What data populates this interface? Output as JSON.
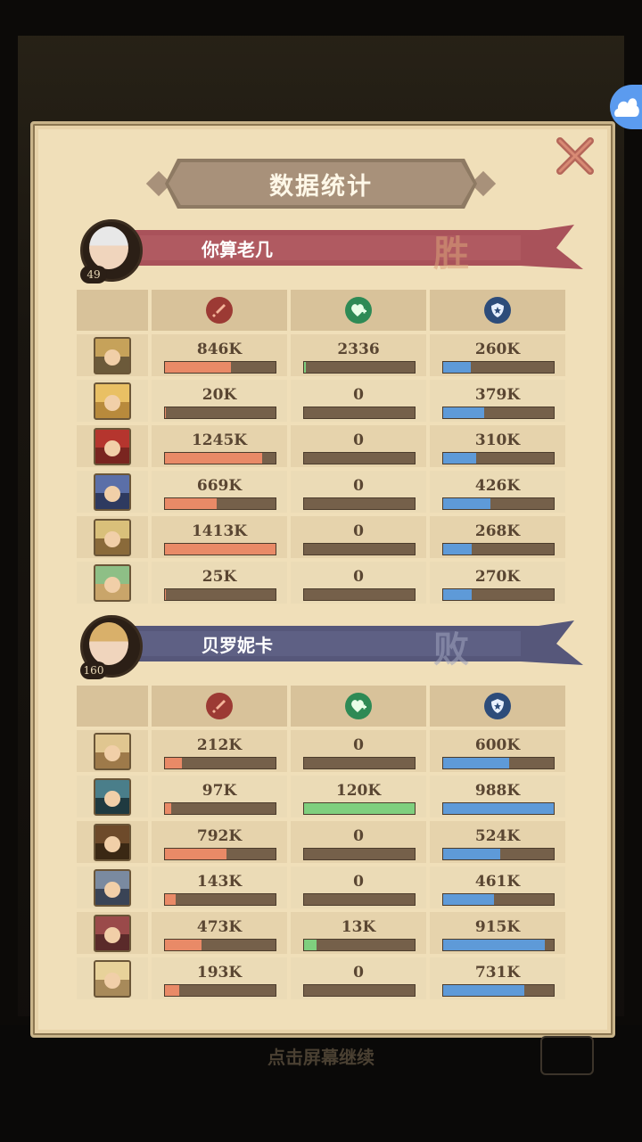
{
  "title": "数据统计",
  "continue_text": "点击屏幕继续",
  "colors": {
    "damage": "#e98a67",
    "healing": "#7fcf7e",
    "tank": "#5e9ad8",
    "win_banner": "#a9525a",
    "lose_banner": "#56577a"
  },
  "column_icons": [
    "sword-icon",
    "heart-plus-icon",
    "shield-icon"
  ],
  "teams": [
    {
      "name": "你算老几",
      "level": "49",
      "result": "胜",
      "heroes": [
        {
          "damage": "846K",
          "damage_pct": 0.6,
          "healing": "2336",
          "healing_pct": 0.02,
          "tank": "260K",
          "tank_pct": 0.25
        },
        {
          "damage": "20K",
          "damage_pct": 0.01,
          "healing": "0",
          "healing_pct": 0,
          "tank": "379K",
          "tank_pct": 0.37
        },
        {
          "damage": "1245K",
          "damage_pct": 0.88,
          "healing": "0",
          "healing_pct": 0,
          "tank": "310K",
          "tank_pct": 0.3
        },
        {
          "damage": "669K",
          "damage_pct": 0.47,
          "healing": "0",
          "healing_pct": 0,
          "tank": "426K",
          "tank_pct": 0.43
        },
        {
          "damage": "1413K",
          "damage_pct": 1.0,
          "healing": "0",
          "healing_pct": 0,
          "tank": "268K",
          "tank_pct": 0.26
        },
        {
          "damage": "25K",
          "damage_pct": 0.01,
          "healing": "0",
          "healing_pct": 0,
          "tank": "270K",
          "tank_pct": 0.26
        }
      ]
    },
    {
      "name": "贝罗妮卡",
      "level": "160",
      "result": "败",
      "heroes": [
        {
          "damage": "212K",
          "damage_pct": 0.15,
          "healing": "0",
          "healing_pct": 0,
          "tank": "600K",
          "tank_pct": 0.6
        },
        {
          "damage": "97K",
          "damage_pct": 0.06,
          "healing": "120K",
          "healing_pct": 1.0,
          "tank": "988K",
          "tank_pct": 1.0
        },
        {
          "damage": "792K",
          "damage_pct": 0.56,
          "healing": "0",
          "healing_pct": 0,
          "tank": "524K",
          "tank_pct": 0.52
        },
        {
          "damage": "143K",
          "damage_pct": 0.1,
          "healing": "0",
          "healing_pct": 0,
          "tank": "461K",
          "tank_pct": 0.46
        },
        {
          "damage": "473K",
          "damage_pct": 0.33,
          "healing": "13K",
          "healing_pct": 0.11,
          "tank": "915K",
          "tank_pct": 0.92
        },
        {
          "damage": "193K",
          "damage_pct": 0.13,
          "healing": "0",
          "healing_pct": 0,
          "tank": "731K",
          "tank_pct": 0.73
        }
      ]
    }
  ]
}
